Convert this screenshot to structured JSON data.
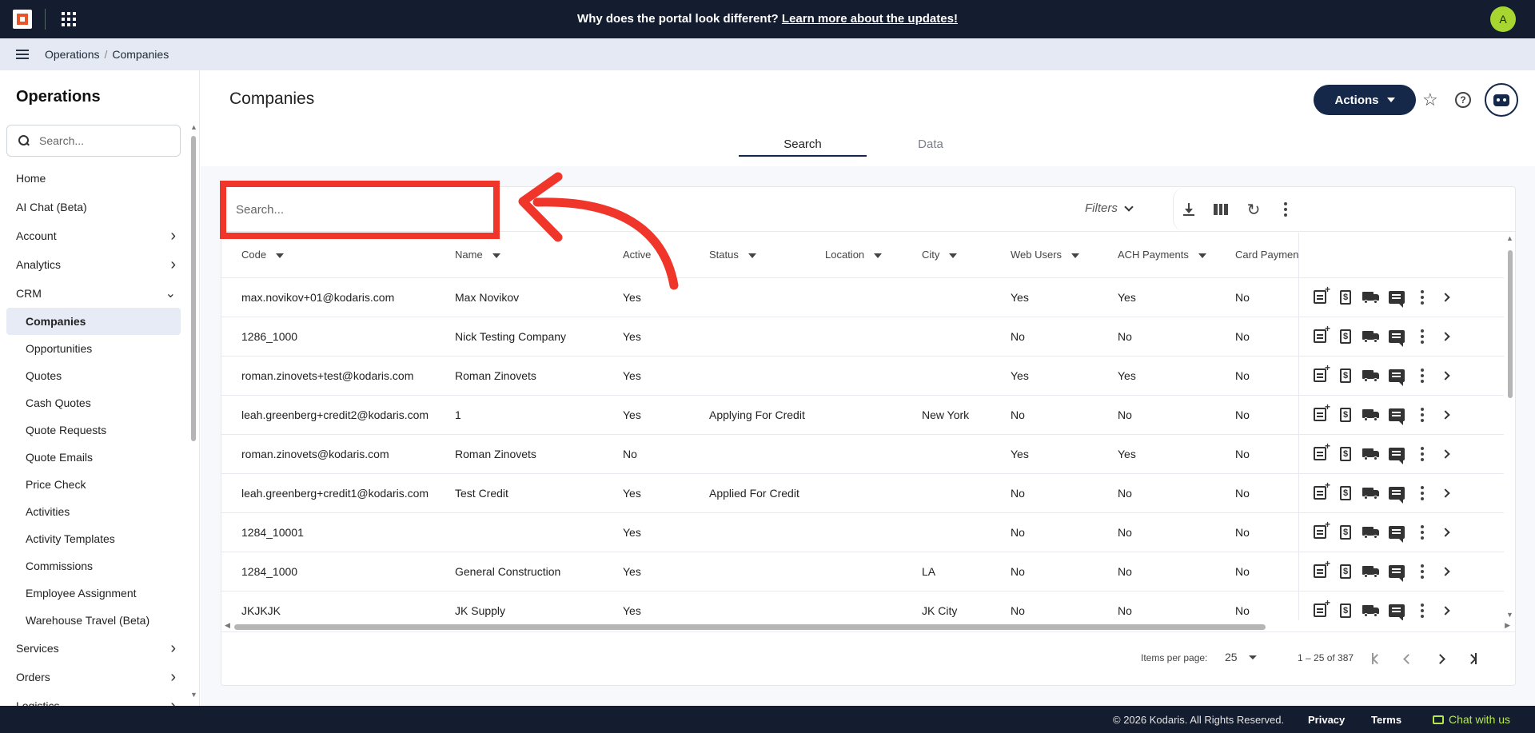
{
  "topbar": {
    "banner_text": "Why does the portal look different?",
    "banner_link": "Learn more about the updates!",
    "avatar_initial": "A"
  },
  "breadcrumb": [
    "Operations",
    "Companies"
  ],
  "breadcrumb_sep": "/",
  "sidebar": {
    "title": "Operations",
    "search_placeholder": "Search...",
    "items": [
      {
        "label": "Home",
        "expandable": false
      },
      {
        "label": "AI Chat (Beta)",
        "expandable": false
      },
      {
        "label": "Account",
        "expandable": true
      },
      {
        "label": "Analytics",
        "expandable": true
      },
      {
        "label": "CRM",
        "expandable": true,
        "expanded": true
      },
      {
        "label": "Companies",
        "sub": true,
        "active": true
      },
      {
        "label": "Opportunities",
        "sub": true
      },
      {
        "label": "Quotes",
        "sub": true
      },
      {
        "label": "Cash Quotes",
        "sub": true
      },
      {
        "label": "Quote Requests",
        "sub": true
      },
      {
        "label": "Quote Emails",
        "sub": true
      },
      {
        "label": "Price Check",
        "sub": true
      },
      {
        "label": "Activities",
        "sub": true
      },
      {
        "label": "Activity Templates",
        "sub": true
      },
      {
        "label": "Commissions",
        "sub": true
      },
      {
        "label": "Employee Assignment",
        "sub": true
      },
      {
        "label": "Warehouse Travel (Beta)",
        "sub": true
      },
      {
        "label": "Services",
        "expandable": true
      },
      {
        "label": "Orders",
        "expandable": true
      },
      {
        "label": "Logistics",
        "expandable": true
      }
    ]
  },
  "page": {
    "title": "Companies",
    "actions_label": "Actions",
    "tabs": [
      "Search",
      "Data"
    ],
    "active_tab": "Search"
  },
  "table_toolbar": {
    "search_placeholder": "Search...",
    "filters_label": "Filters"
  },
  "table": {
    "columns": [
      "Code",
      "Name",
      "Active",
      "Status",
      "Location",
      "City",
      "Web Users",
      "ACH Payments",
      "Card Payments"
    ],
    "rows": [
      [
        "max.novikov+01@kodaris.com",
        "Max Novikov",
        "Yes",
        "",
        "",
        "",
        "Yes",
        "Yes",
        "No"
      ],
      [
        "1286_1000",
        "Nick Testing Company",
        "Yes",
        "",
        "",
        "",
        "No",
        "No",
        "No"
      ],
      [
        "roman.zinovets+test@kodaris.com",
        "Roman Zinovets",
        "Yes",
        "",
        "",
        "",
        "Yes",
        "Yes",
        "No"
      ],
      [
        "leah.greenberg+credit2@kodaris.com",
        "1",
        "Yes",
        "Applying For Credit",
        "",
        "New York",
        "No",
        "No",
        "No"
      ],
      [
        "roman.zinovets@kodaris.com",
        "Roman Zinovets",
        "No",
        "",
        "",
        "",
        "Yes",
        "Yes",
        "No"
      ],
      [
        "leah.greenberg+credit1@kodaris.com",
        "Test Credit",
        "Yes",
        "Applied For Credit",
        "",
        "",
        "No",
        "No",
        "No"
      ],
      [
        "1284_10001",
        "",
        "Yes",
        "",
        "",
        "",
        "No",
        "No",
        "No"
      ],
      [
        "1284_1000",
        "General Construction",
        "Yes",
        "",
        "",
        "LA",
        "No",
        "No",
        "No"
      ],
      [
        "JKJKJK",
        "JK Supply",
        "Yes",
        "",
        "",
        "JK City",
        "No",
        "No",
        "No"
      ]
    ],
    "row_action_icons": [
      "add-note-icon",
      "quote-icon",
      "shipping-icon",
      "comment-icon",
      "more-vert-icon",
      "chevron-right-icon"
    ]
  },
  "pagination": {
    "items_per_page_label": "Items per page:",
    "items_per_page": "25",
    "range": "1 – 25 of 387"
  },
  "footer": {
    "copyright": "© 2026 Kodaris. All Rights Reserved.",
    "privacy": "Privacy",
    "terms": "Terms",
    "chat": "Chat with us"
  },
  "colors": {
    "topbar": "#141c2f",
    "primary": "#16284a",
    "annotation": "#f0362a",
    "accent_green": "#b6e84a"
  }
}
